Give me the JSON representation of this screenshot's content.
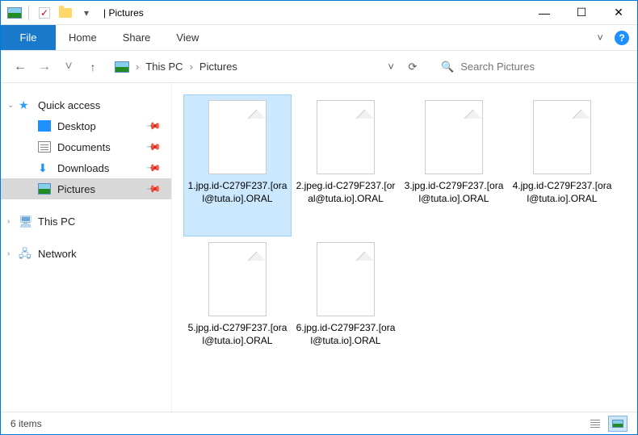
{
  "titlebar": {
    "title": "Pictures"
  },
  "window_controls": {
    "minimize": "—",
    "maximize": "☐",
    "close": "✕"
  },
  "ribbon": {
    "file": "File",
    "tabs": [
      "Home",
      "Share",
      "View"
    ],
    "expand": "˅",
    "help": "?"
  },
  "nav": {
    "back": "←",
    "forward": "→",
    "recent": "˅",
    "up": "↑",
    "breadcrumb": [
      "This PC",
      "Pictures"
    ],
    "crumb_sep": "›",
    "addr_dropdown": "˅",
    "refresh": "⟳"
  },
  "search": {
    "placeholder": "Search Pictures",
    "icon": "🔍"
  },
  "tree": {
    "quick_access": {
      "label": "Quick access",
      "expanded": true,
      "items": [
        {
          "label": "Desktop",
          "pinned": true
        },
        {
          "label": "Documents",
          "pinned": true
        },
        {
          "label": "Downloads",
          "pinned": true
        },
        {
          "label": "Pictures",
          "pinned": true,
          "selected": true
        }
      ]
    },
    "this_pc": {
      "label": "This PC"
    },
    "network": {
      "label": "Network"
    }
  },
  "files": [
    {
      "name": "1.jpg.id-C279F237.[oral@tuta.io].ORAL",
      "selected": true
    },
    {
      "name": "2.jpeg.id-C279F237.[oral@tuta.io].ORAL"
    },
    {
      "name": "3.jpg.id-C279F237.[oral@tuta.io].ORAL"
    },
    {
      "name": "4.jpg.id-C279F237.[oral@tuta.io].ORAL"
    },
    {
      "name": "5.jpg.id-C279F237.[oral@tuta.io].ORAL"
    },
    {
      "name": "6.jpg.id-C279F237.[oral@tuta.io].ORAL"
    }
  ],
  "status": {
    "count_label": "6 items"
  }
}
